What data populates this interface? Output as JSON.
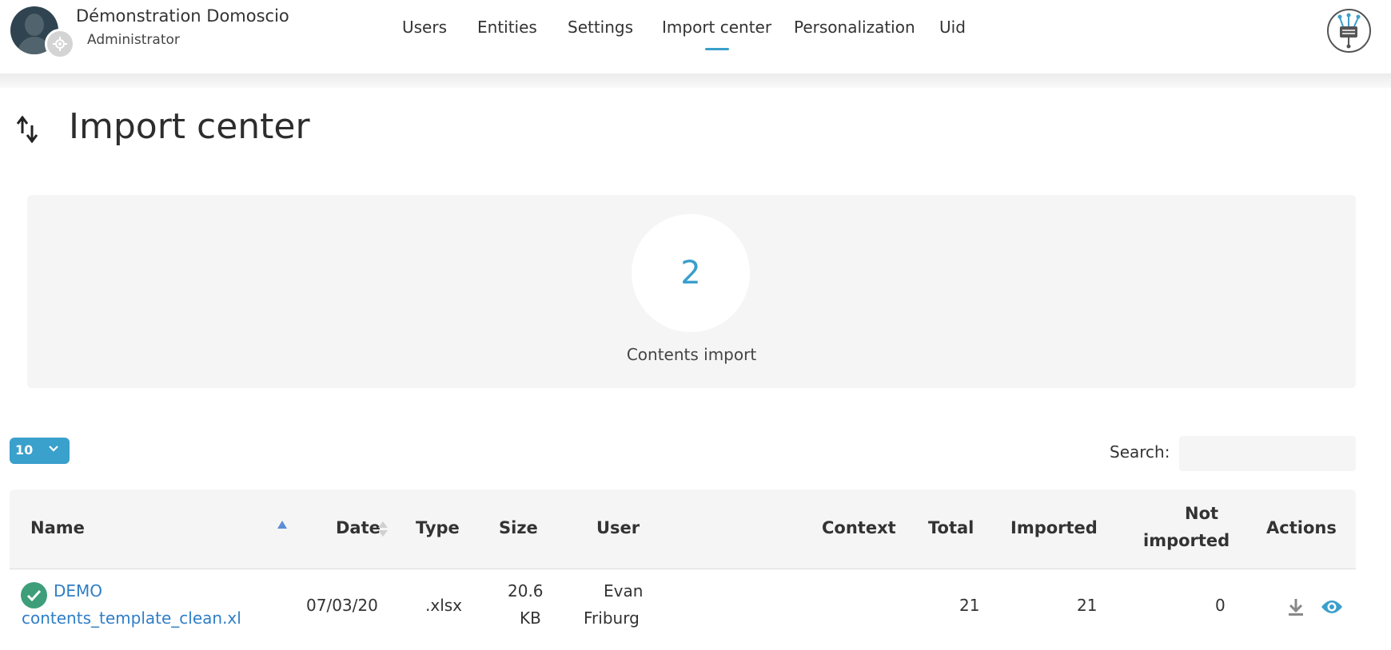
{
  "app": {
    "user_name": "Démonstration Domoscio",
    "user_role": "Administrator",
    "logo_icon": "domoscio-logo-icon"
  },
  "nav": {
    "items": [
      {
        "label": "Users",
        "active": false
      },
      {
        "label": "Entities",
        "active": false
      },
      {
        "label": "Settings",
        "active": false
      },
      {
        "label": "Import center",
        "active": true
      },
      {
        "label": "Personalization",
        "active": false
      },
      {
        "label": "Uid",
        "active": false
      }
    ]
  },
  "page": {
    "title": "Import center",
    "title_icon": "import-export-arrows-icon"
  },
  "stats": {
    "count": "2",
    "label": "Contents import"
  },
  "table_controls": {
    "page_length": "10",
    "search_label": "Search:",
    "search_value": ""
  },
  "table": {
    "columns": [
      "Name",
      "Date",
      "Type",
      "Size",
      "User",
      "Context",
      "Total",
      "Imported",
      "Not imported",
      "Actions"
    ],
    "not_imported_line1": "Not",
    "not_imported_line2": "imported",
    "sort": {
      "column": "Name",
      "direction": "ascending"
    },
    "rows": [
      {
        "status_icon": "check-circle-icon",
        "name_line1": "DEMO",
        "name_line2": "contents_template_clean.xl",
        "date": "07/03/20",
        "type": ".xlsx",
        "size_line1": "20.6",
        "size_line2": "KB",
        "user_line1": "Evan",
        "user_line2": "Friburg",
        "context": "",
        "total": "21",
        "imported": "21",
        "not_imported": "0",
        "actions": [
          "download-icon",
          "eye-icon"
        ]
      }
    ]
  },
  "colors": {
    "accent": "#3a9fcb",
    "link": "#2f7ec6",
    "success": "#3e9e7a",
    "panel_bg": "#f5f5f5"
  }
}
